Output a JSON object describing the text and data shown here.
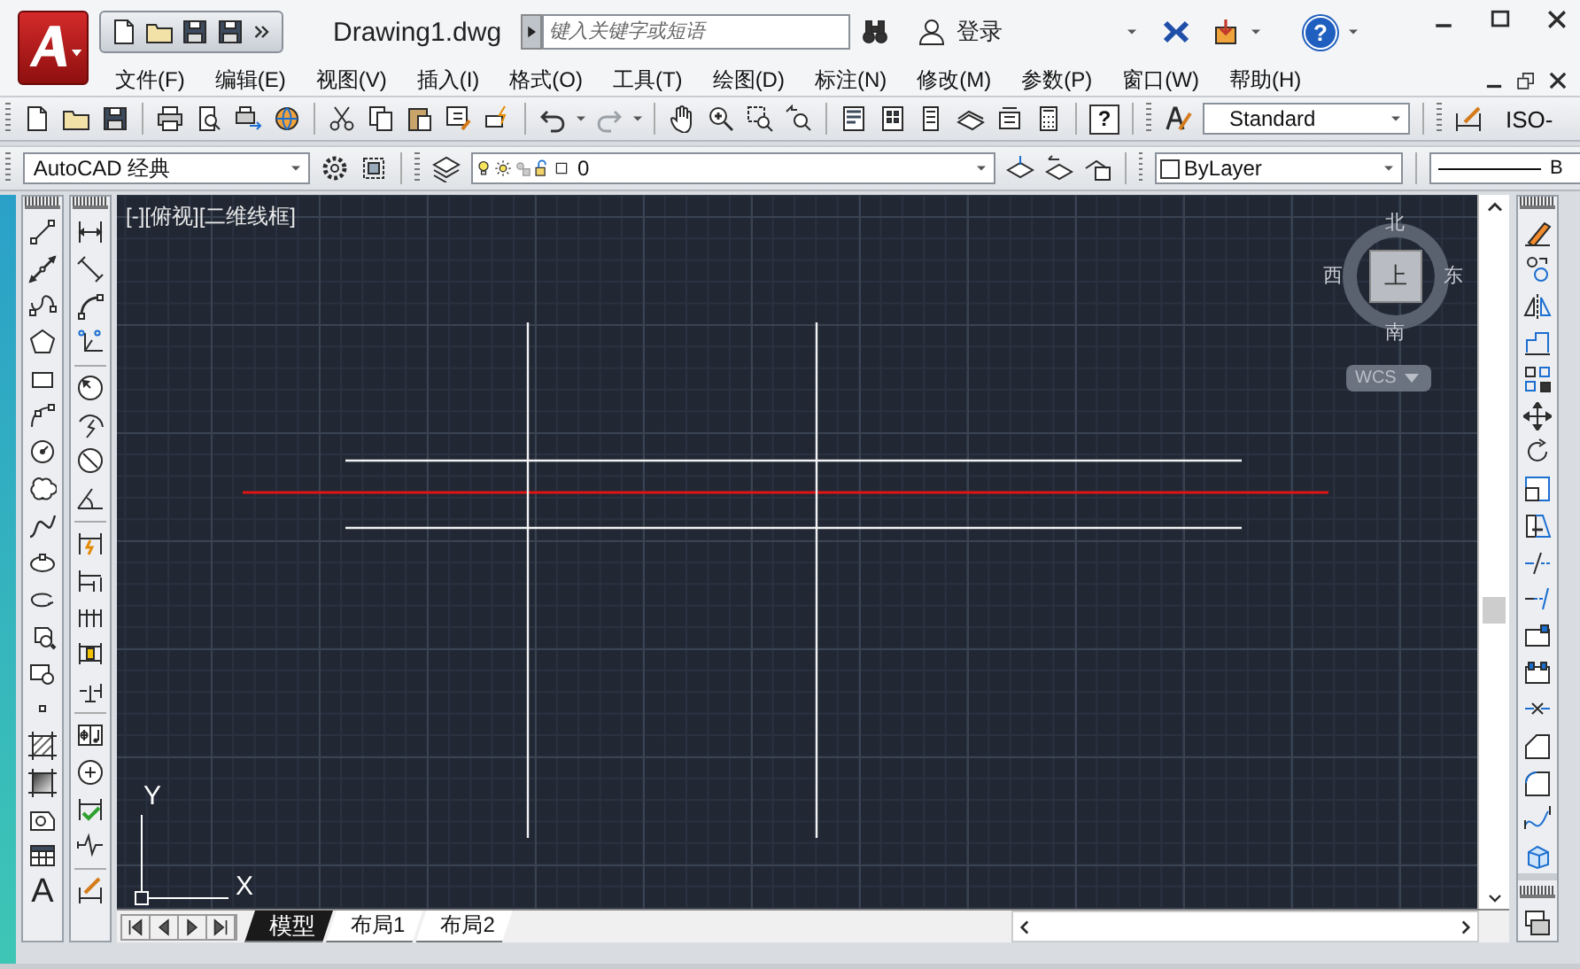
{
  "title_bar": {
    "document_title": "Drawing1.dwg",
    "search_placeholder": "键入关键字或短语",
    "sign_in": "登录",
    "help_glyph": "?"
  },
  "menu_bar": [
    {
      "label": "文件(F)"
    },
    {
      "label": "编辑(E)"
    },
    {
      "label": "视图(V)"
    },
    {
      "label": "插入(I)"
    },
    {
      "label": "格式(O)"
    },
    {
      "label": "工具(T)"
    },
    {
      "label": "绘图(D)"
    },
    {
      "label": "标注(N)"
    },
    {
      "label": "修改(M)"
    },
    {
      "label": "参数(P)"
    },
    {
      "label": "窗口(W)"
    },
    {
      "label": "帮助(H)"
    }
  ],
  "toolbars": {
    "help_glyph": "?",
    "text_style": "Standard",
    "dimension_style": "ISO-",
    "workspace": "AutoCAD 经典",
    "layer": "0",
    "color_setting": "ByLayer",
    "linetype": "B"
  },
  "draw_toolbar": {
    "text_glyph": "A"
  },
  "viewport": {
    "label": "[-][俯视][二维线框]",
    "viewcube": {
      "north": "北",
      "south": "南",
      "west": "西",
      "east": "东",
      "face": "上",
      "coordinate_system": "WCS"
    },
    "ucs_icon": {
      "x_axis": "X",
      "y_axis": "Y"
    }
  },
  "layout_tabs": [
    {
      "label": "模型",
      "selected": true
    },
    {
      "label": "布局1",
      "selected": false
    },
    {
      "label": "布局2",
      "selected": false
    }
  ]
}
